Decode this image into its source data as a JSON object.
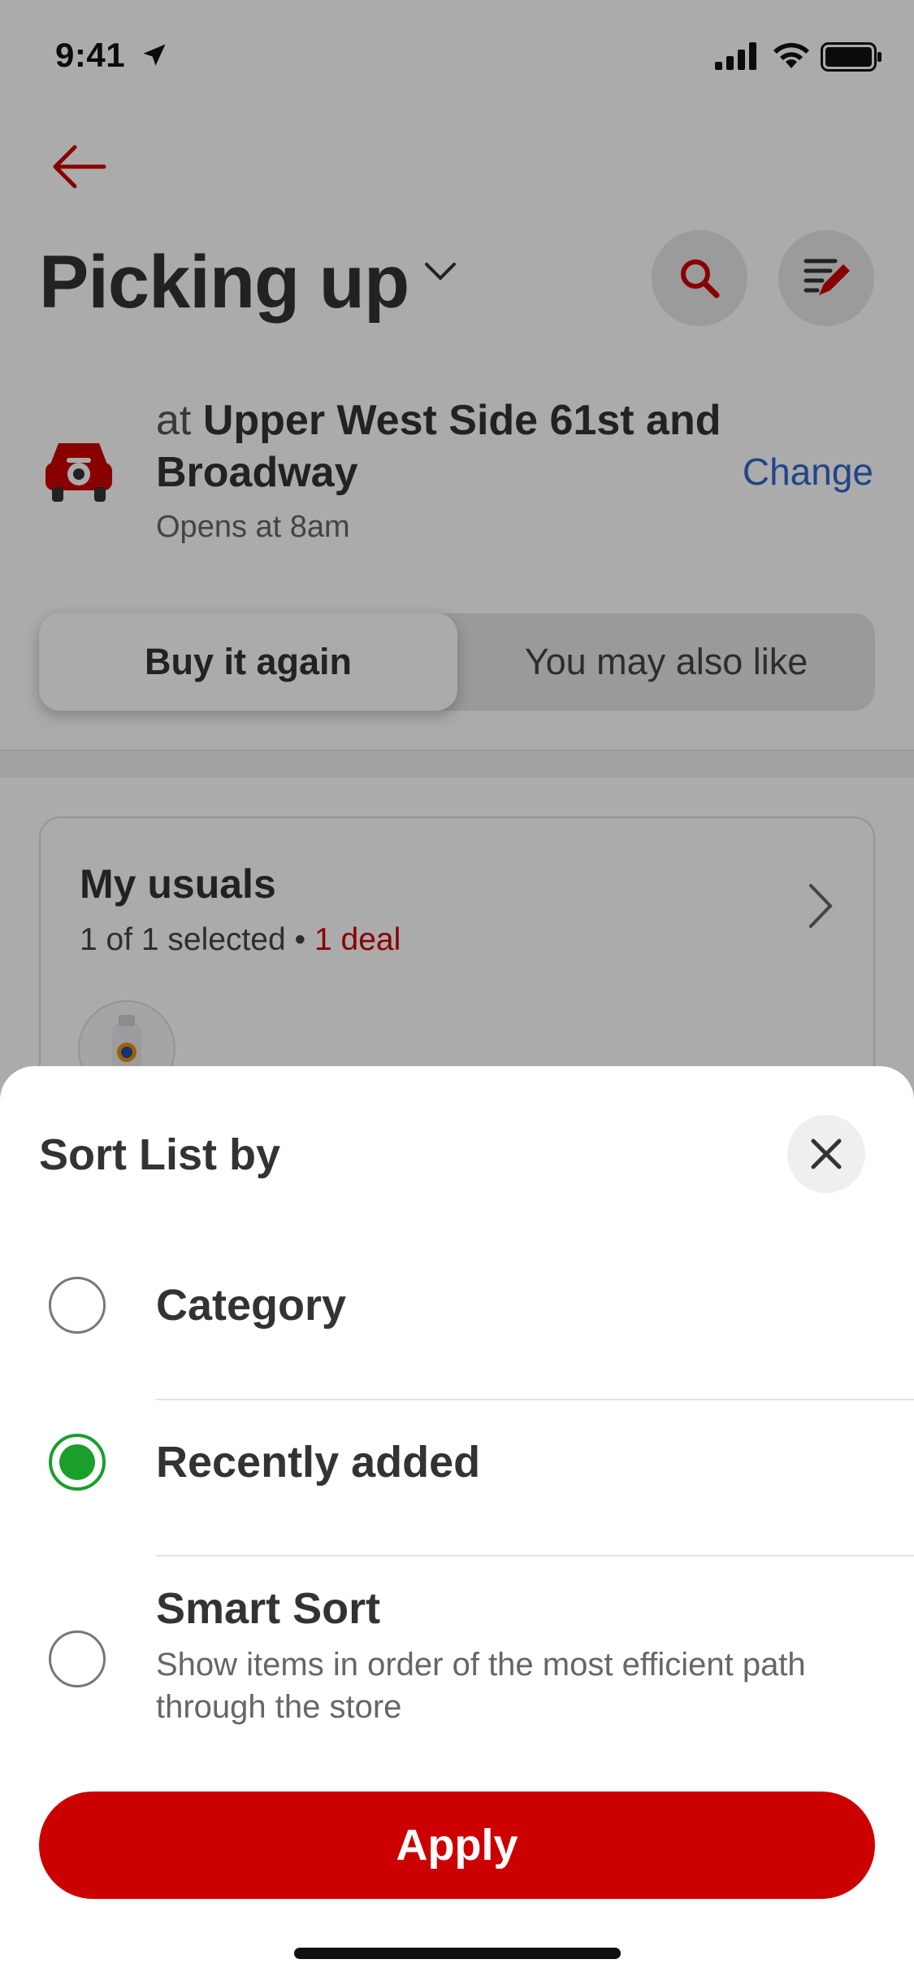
{
  "status_bar": {
    "time": "9:41"
  },
  "header": {
    "title": "Picking up"
  },
  "store": {
    "prefix": "at",
    "name": "Upper West Side 61st and Broadway",
    "hours": "Opens at 8am",
    "change_label": "Change"
  },
  "segments": {
    "active": "Buy it again",
    "inactive": "You may also like"
  },
  "card": {
    "title": "My usuals",
    "selected_text": "1 of 1 selected",
    "separator": "•",
    "deal_text": "1 deal"
  },
  "sheet": {
    "title": "Sort List by",
    "options": [
      {
        "label": "Category",
        "selected": false
      },
      {
        "label": "Recently added",
        "selected": true
      },
      {
        "label": "Smart Sort",
        "description": "Show items in order of the most efficient path through the store",
        "selected": false
      }
    ],
    "apply_label": "Apply"
  },
  "colors": {
    "brand_red": "#cc0000",
    "selected_green": "#1a9e2c",
    "link_blue": "#3366cc"
  }
}
